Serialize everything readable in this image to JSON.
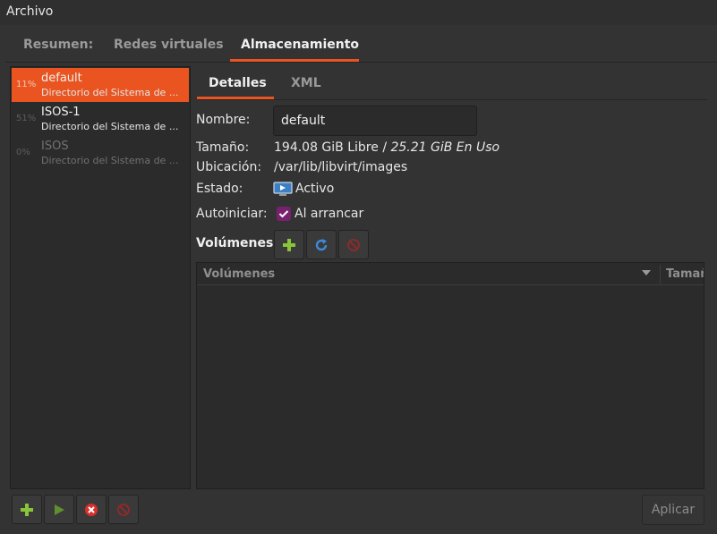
{
  "menubar": {
    "archivo": "Archivo"
  },
  "main_tabs": [
    {
      "label": "Resumen:"
    },
    {
      "label": "Redes virtuales"
    },
    {
      "label": "Almacenamiento"
    }
  ],
  "pools": [
    {
      "percent": "11%",
      "name": "default",
      "desc": "Directorio del Sistema de ...",
      "selected": true
    },
    {
      "percent": "51%",
      "name": "ISOS-1",
      "desc": "Directorio del Sistema de ...",
      "selected": false
    },
    {
      "percent": "0%",
      "name": "ISOS",
      "desc": "Directorio del Sistema de ...",
      "selected": false
    }
  ],
  "sub_tabs": [
    {
      "label": "Detalles"
    },
    {
      "label": "XML"
    }
  ],
  "details": {
    "name_label": "Nombre:",
    "name_value": "default",
    "size_label": "Tamaño:",
    "size_free": "194.08 GiB Libre / ",
    "size_used": "25.21 GiB En Uso",
    "location_label": "Ubicación:",
    "location_value": "/var/lib/libvirt/images",
    "state_label": "Estado:",
    "state_value": "Activo",
    "autostart_label": "Autoiniciar:",
    "autostart_value": "Al arrancar"
  },
  "volumes": {
    "title": "Volúmenes",
    "col_name": "Volúmenes",
    "col_size": "Tamaño"
  },
  "icons": {
    "add": "add-icon",
    "refresh": "refresh-icon",
    "delete": "stop-icon",
    "play": "play-icon",
    "stop": "cancel-icon"
  },
  "colors": {
    "accent": "#e95420",
    "checkbox": "#77216f"
  },
  "footer": {
    "apply": "Aplicar"
  }
}
